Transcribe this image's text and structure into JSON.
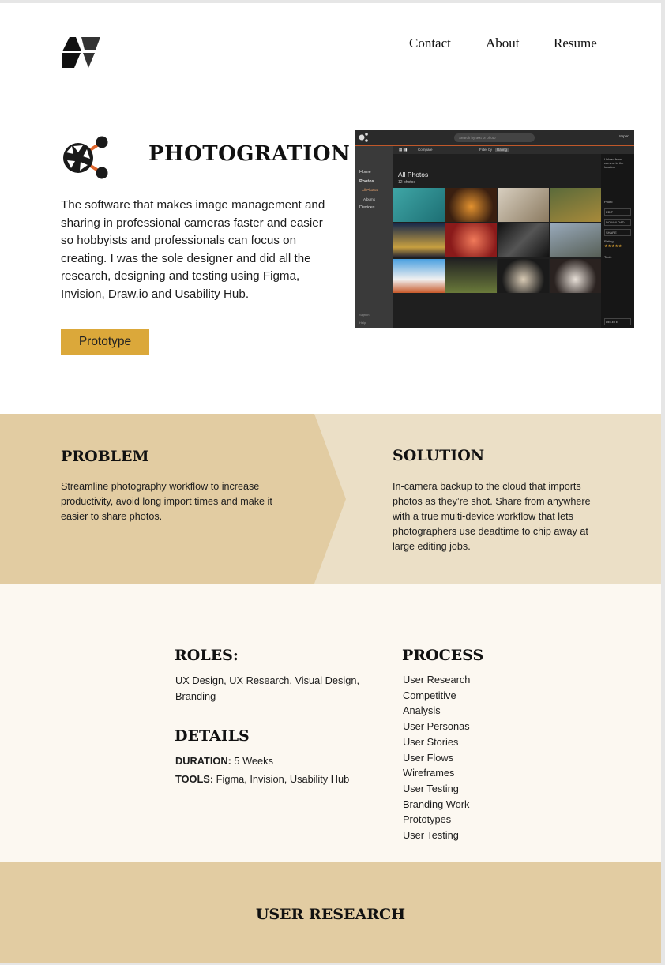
{
  "nav": {
    "contact": "Contact",
    "about": "About",
    "resume": "Resume"
  },
  "hero": {
    "title": "PHOTOGRATION",
    "description": "The software that makes image management and sharing in professional cameras faster and  easier so hobbyists and professionals can focus on creating. I was the sole designer and did all the research, designing and testing using Figma, Invision, Draw.io and Usability Hub.",
    "cta_label": "Prototype",
    "accent": "#dba83a"
  },
  "mockup": {
    "search_placeholder": "Search by text or photo",
    "import": "Import",
    "sidebar": [
      "Home",
      "Photos",
      "All Photos",
      "Albums",
      "Devices"
    ],
    "sidebar_bottom": [
      "Sign In",
      "Help"
    ],
    "toolbar": {
      "compare": "Compare",
      "filter": "Filter by",
      "filter_value": "Rating"
    },
    "heading": "All Photos",
    "count": "12 photos",
    "right_panel": [
      "Upload from camera to the location",
      "Photo",
      "EDIT",
      "DOWNLOAD",
      "SHARE",
      "Rating",
      "Tools",
      "DELETE"
    ],
    "rating": "★★★★★"
  },
  "problem": {
    "heading": "PROBLEM",
    "text": "Streamline photography workflow to increase productivity, avoid long import times and make it easier to share photos."
  },
  "solution": {
    "heading": "SOLUTION",
    "text": "In-camera backup to the cloud that imports photos as they’re shot. Share from anywhere with a true multi-device workflow that lets photographers use deadtime to chip away at large editing jobs."
  },
  "roles": {
    "heading": "ROLES:",
    "text": "UX Design, UX Research, Visual Design, Branding"
  },
  "details": {
    "heading": "DETAILS",
    "duration_label": "DURATION:",
    "duration_value": " 5 Weeks",
    "tools_label": "TOOLS:",
    "tools_value": " Figma, Invision, Usability Hub"
  },
  "process": {
    "heading": "PROCESS",
    "items": [
      "User Research",
      "Competitive",
      "Analysis",
      "User Personas",
      "User Stories",
      "User Flows",
      "Wireframes",
      "User Testing",
      "Branding Work",
      "Prototypes",
      "User Testing"
    ]
  },
  "research": {
    "heading": "USER RESEARCH"
  },
  "colors": {
    "band_left": "#e2cca2",
    "band_right": "#ebdfc6",
    "cream": "#fcf8f1",
    "research_bg": "#e2cca2",
    "icon_orange": "#e0652b"
  }
}
